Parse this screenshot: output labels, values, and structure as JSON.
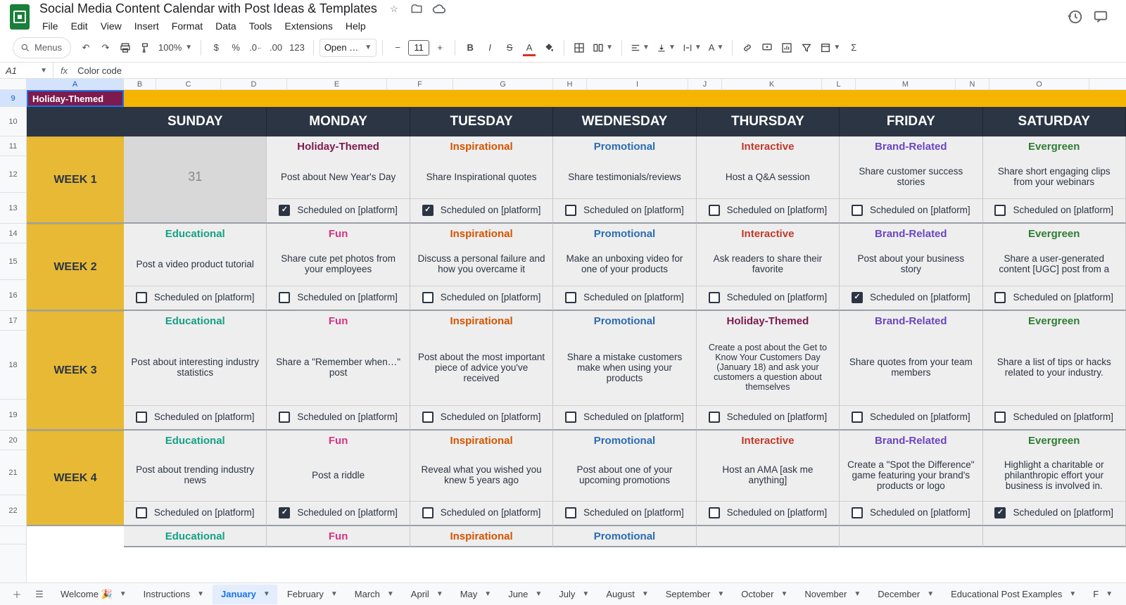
{
  "doc": {
    "title": "Social Media Content Calendar with Post Ideas & Templates"
  },
  "menus": [
    "File",
    "Edit",
    "View",
    "Insert",
    "Format",
    "Data",
    "Tools",
    "Extensions",
    "Help"
  ],
  "toolbar": {
    "search_placeholder": "Menus",
    "zoom": "100%",
    "font_name": "Open …",
    "font_size": "11"
  },
  "name_box": "A1",
  "formula": "Color code",
  "col_letters": [
    "A",
    "B",
    "C",
    "D",
    "E",
    "F",
    "G",
    "H",
    "I",
    "J",
    "K",
    "L",
    "M",
    "N",
    "O"
  ],
  "row_numbers": [
    "9",
    "10",
    "11",
    "12",
    "13",
    "14",
    "15",
    "16",
    "17",
    "18",
    "19",
    "20",
    "21",
    "22",
    ""
  ],
  "a9_value": "Holiday-Themed",
  "days": [
    "SUNDAY",
    "MONDAY",
    "TUESDAY",
    "WEDNESDAY",
    "THURSDAY",
    "FRIDAY",
    "SATURDAY"
  ],
  "week1_label": "WEEK 1",
  "week2_label": "WEEK 2",
  "week3_label": "WEEK 3",
  "week4_label": "WEEK 4",
  "muted_date": "31",
  "sched_text": "Scheduled on [platform]",
  "cats": {
    "holiday": "Holiday-Themed",
    "insp": "Inspirational",
    "promo": "Promotional",
    "inter": "Interactive",
    "brand": "Brand-Related",
    "ever": "Evergreen",
    "edu": "Educational",
    "fun": "Fun"
  },
  "w1": {
    "mon": "Post about New Year's Day",
    "tue": "Share Inspirational quotes",
    "wed": "Share testimonials/reviews",
    "thu": "Host a Q&A session",
    "fri": "Share customer success stories",
    "sat": "Share short engaging clips from your webinars"
  },
  "w2": {
    "sun": "Post a video product tutorial",
    "mon": "Share cute pet photos from your employees",
    "tue": "Discuss a personal failure and how you overcame it",
    "wed": "Make an unboxing video for one of your products",
    "thu": "Ask readers to share their favorite",
    "fri": "Post about your business story",
    "sat": "Share a user-generated content [UGC] post from a"
  },
  "w3": {
    "sun": "Post about interesting industry statistics",
    "mon": "Share a \"Remember when…\" post",
    "tue": "Post about the most important piece of advice you've received",
    "wed": "Share a mistake customers make when using your products",
    "thu": "Create a post about the Get to Know Your Customers Day (January 18) and ask your customers a question about themselves",
    "fri": "Share quotes from your team members",
    "sat": "Share a list of tips or hacks related to your industry."
  },
  "w4": {
    "sun": "Post about trending industry news",
    "mon": "Post a riddle",
    "tue": "Reveal what you wished you knew 5 years ago",
    "wed": "Post about one of your upcoming promotions",
    "thu": "Host an AMA [ask me anything]",
    "fri": "Create a \"Spot the Difference\" game featuring your brand's products or logo",
    "sat": "Highlight a charitable or philanthropic effort your business is involved in."
  },
  "sheet_tabs": [
    "Welcome 🎉",
    "Instructions",
    "January",
    "February",
    "March",
    "April",
    "May",
    "June",
    "July",
    "August",
    "September",
    "October",
    "November",
    "December",
    "Educational Post Examples",
    "F"
  ]
}
